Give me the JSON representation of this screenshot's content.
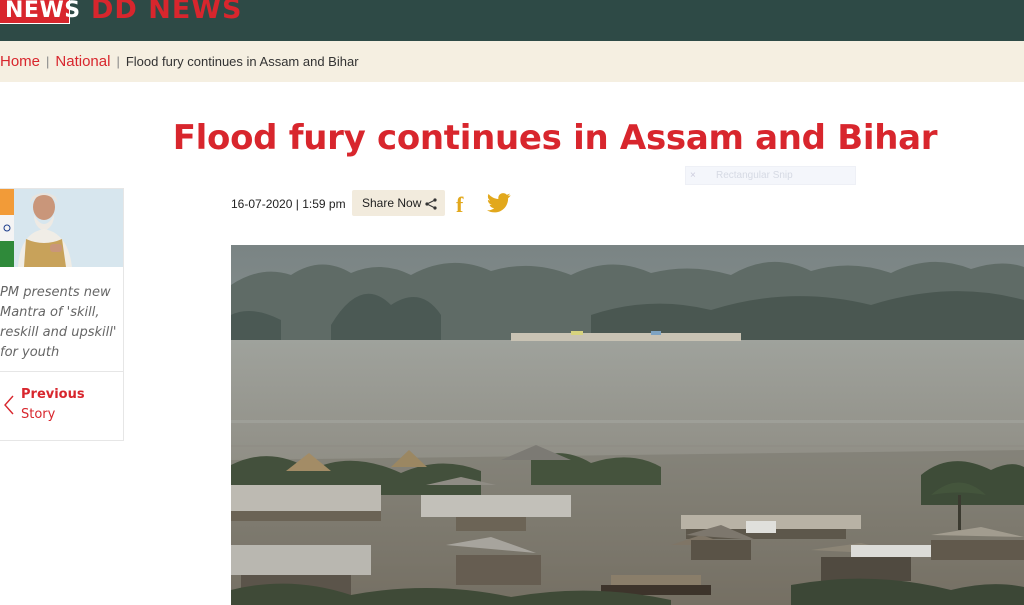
{
  "header": {
    "logo_text": "NEWS",
    "brand": "DD NEWS",
    "colors": {
      "bar": "#2e4a46",
      "accent": "#d8262d"
    }
  },
  "breadcrumb": {
    "home": "Home",
    "section": "National",
    "current": "Flood fury continues in Assam and Bihar",
    "separator": "|"
  },
  "article": {
    "title": "Flood fury continues in Assam and Bihar",
    "date": "16-07-2020",
    "time": "1:59 pm",
    "date_separator": "|",
    "share_label": "Share Now",
    "facebook_glyph": "f",
    "hero_image": "flood-houses-submerged"
  },
  "snip_tooltip": {
    "close": "×",
    "label": "Rectangular Snip"
  },
  "sidebar": {
    "related_story": {
      "image": "pm-portrait",
      "text": "PM presents new Mantra of 'skill, reskill and upskill' for youth"
    },
    "previous": {
      "line1": "Previous",
      "line2": "Story"
    }
  }
}
